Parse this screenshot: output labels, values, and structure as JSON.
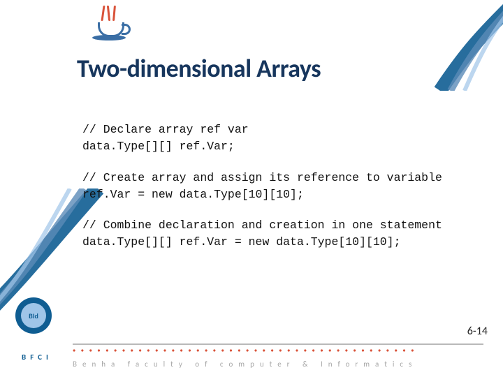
{
  "title": "Two-dimensional Arrays",
  "code": {
    "block1": {
      "comment": "// Declare array ref var",
      "line": "data.Type[][] ref.Var;"
    },
    "block2": {
      "comment": "// Create array and assign its reference to variable",
      "line": "ref.Var = new data.Type[10][10];"
    },
    "block3": {
      "comment": "// Combine declaration and creation in one statement",
      "line": "data.Type[][] ref.Var = new data.Type[10][10];"
    }
  },
  "badge": "BId",
  "bfci": "BFCI",
  "dots": "● ● ● ● ● ● ● ● ● ● ● ● ● ● ● ● ● ● ● ● ● ● ● ● ● ● ● ● ● ● ● ● ● ● ● ● ● ● ● ● ● ●",
  "footer": "Benha faculty of computer & Informatics",
  "page": "6-14"
}
